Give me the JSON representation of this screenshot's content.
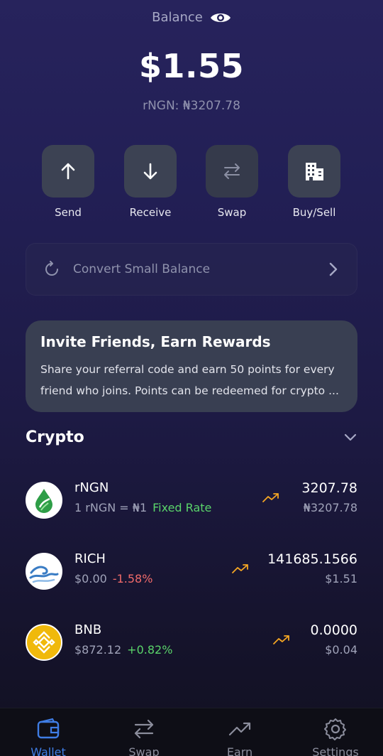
{
  "balance": {
    "label": "Balance",
    "amount": "$1.55",
    "sub": "rNGN: ₦3207.78"
  },
  "actions": [
    {
      "label": "Send",
      "icon": "arrow-up-icon"
    },
    {
      "label": "Receive",
      "icon": "arrow-down-icon"
    },
    {
      "label": "Swap",
      "icon": "swap-icon"
    },
    {
      "label": "Buy/Sell",
      "icon": "building-icon"
    }
  ],
  "convert": {
    "label": "Convert Small Balance"
  },
  "invite": {
    "title": "Invite Friends, Earn Rewards",
    "line1": "Share your referral code and earn 50 points for every",
    "line2": "friend who joins. Points can be redeemed for crypto ..."
  },
  "crypto": {
    "title": "Crypto",
    "assets": [
      {
        "name": "rNGN",
        "price": "1 rNGN = ₦1",
        "tag": "Fixed Rate",
        "amount": "3207.78",
        "fiat": "₦3207.78"
      },
      {
        "name": "RICH",
        "price": "$0.00",
        "change": "-1.58%",
        "amount": "141685.1566",
        "fiat": "$1.51"
      },
      {
        "name": "BNB",
        "price": "$872.12",
        "change": "+0.82%",
        "amount": "0.0000",
        "fiat": "$0.04"
      }
    ]
  },
  "tabs": [
    {
      "label": "Wallet",
      "icon": "wallet-icon",
      "active": true
    },
    {
      "label": "Swap",
      "icon": "swap-icon"
    },
    {
      "label": "Earn",
      "icon": "trending-up-icon"
    },
    {
      "label": "Settings",
      "icon": "gear-icon"
    }
  ],
  "colors": {
    "accent": "#3f7de5",
    "positive": "#5ad46a",
    "negative": "#f06a6a",
    "trend": "#f5a623"
  }
}
